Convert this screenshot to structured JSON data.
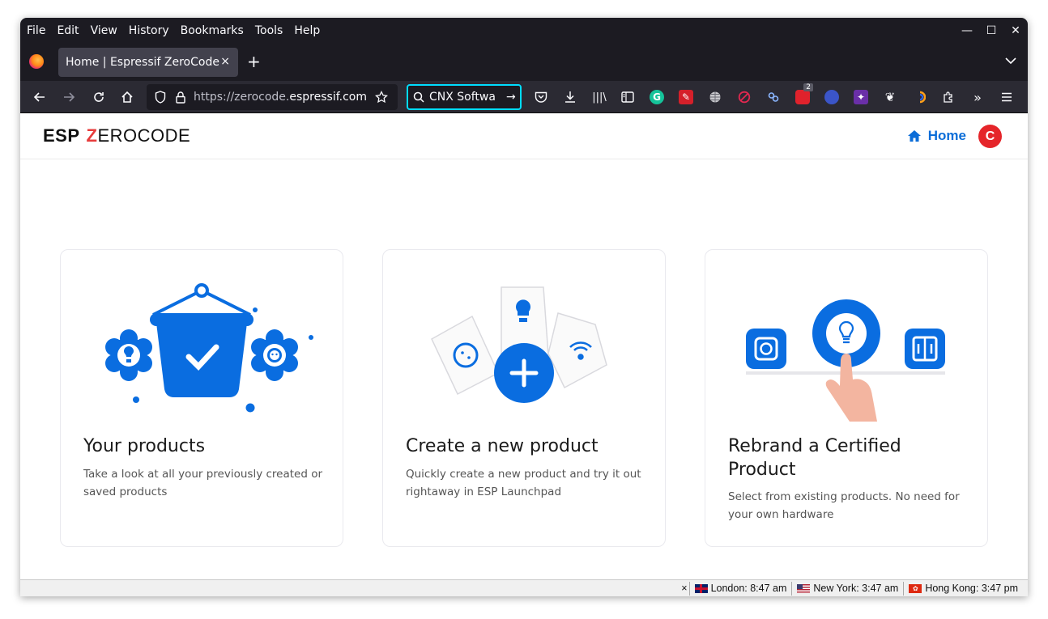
{
  "menubar": {
    "items": [
      "File",
      "Edit",
      "View",
      "History",
      "Bookmarks",
      "Tools",
      "Help"
    ]
  },
  "tab": {
    "title": "Home | Espressif ZeroCode",
    "close": "×"
  },
  "newtab": "+",
  "urlbar": {
    "url_prefix": "https://zerocode.",
    "url_domain": "espressif.com"
  },
  "searchbox": {
    "value": "CNX Softwa",
    "go": "→"
  },
  "extensions": {
    "badge_count": "2"
  },
  "site": {
    "logo_left": "ESP",
    "logo_z": "Z",
    "logo_right": "EROCODE",
    "home_label": "Home",
    "avatar_letter": "C"
  },
  "cards": [
    {
      "title": "Your products",
      "desc": "Take a look at all your previously created or saved products"
    },
    {
      "title": "Create a new product",
      "desc": "Quickly create a new product and try it out rightaway in ESP Launchpad"
    },
    {
      "title": "Rebrand a Certified Product",
      "desc": "Select from existing products. No need for your own hardware"
    }
  ],
  "statusbar": {
    "close": "×",
    "clocks": [
      "London: 8:47 am",
      "New York: 3:47 am",
      "Hong Kong: 3:47 pm"
    ]
  },
  "colors": {
    "accent": "#0b6dd8",
    "brand_red": "#e73c3c",
    "illus_blue": "#0a6de0"
  }
}
